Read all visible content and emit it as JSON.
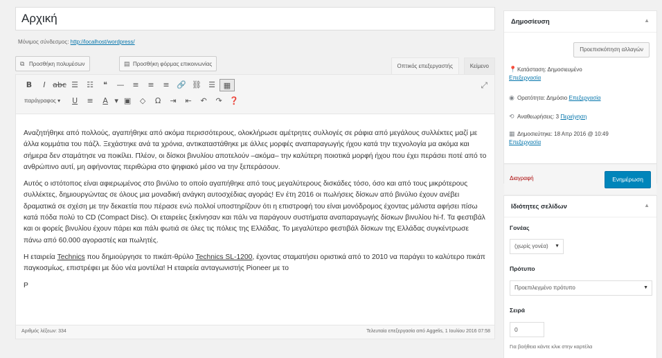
{
  "post": {
    "title": "Αρχική",
    "permalink_label": "Μόνιμος σύνδεσμος:",
    "permalink_url": "http://localhost/wordpress/"
  },
  "media": {
    "add_media": "Προσθήκη πολυμέσων",
    "add_form": "Προσθήκη φόρμας επικοινωνίας"
  },
  "editor_tabs": {
    "visual": "Οπτικός επεξεργαστής",
    "text": "Κείμενο"
  },
  "toolbar": {
    "row1": [
      "B",
      "I",
      "≡",
      "☰",
      "☷",
      "❝",
      "—",
      "≡",
      "≡",
      "≡",
      "🔗",
      "⛓",
      "☰",
      "▦"
    ],
    "row2": [
      "U",
      "≡",
      "A",
      "▾",
      "▣",
      "◇",
      "Ω",
      "⇥",
      "⇤",
      "↶",
      "↷",
      "❓"
    ],
    "format_select": "παράγραφος ▾",
    "expand_icon": "⤢"
  },
  "content": {
    "p1": "Αναζητήθηκε από πολλούς, αγαπήθηκε από ακόμα περισσότερους, ολοκλήρωσε αμέτρητες συλλογές σε ράφια από μεγάλους συλλέκτες μαζί με άλλα κομμάτια του πάζλ. Ξεχάστηκε ανά τα χρόνια, αντικαταστάθηκε με άλλες μορφές αναπαραγωγής ήχου κατά την τεχνολογία μα ακόμα και σήμερα δεν σταμάτησε να ποικίλει. Πλέον, οι δίσκοι βινυλίου αποτελούν –ακόμα– την καλύτερη ποιοτικά μορφή ήχου που έχει περάσει ποτέ από το ανθρώπινο αυτί, μη αφήνοντας περιθώρια στο ψηφιακό μέσο να την ξεπεράσουν.",
    "p2": "Αυτός ο ιστότοπος είναι αφιερωμένος στο βινύλιο το οποίο αγαπήθηκε από τους μεγαλύτερους δισκάδες τόσο, όσο και από τους μικρότερους συλλέκτες, δημιουργώντας σε όλους μια μοναδική ανάγκη αυτοσχέδιας αγοράς! Εν έτη 2016 οι πωλήσεις δίσκων από βινύλιο έχουν ανέβει δραματικά σε σχέση με την δεκαετία που πέρασε ενώ πολλοί υποστηρίζουν ότι η επιστροφή του είναι μονόδρομος έχοντας μάλιστα αφήσει πίσω κατά πόδα πολύ το CD (Compact Disc). Οι εταιρείες ξεκίνησαν και πάλι να παράγουν συστήματα αναπαραγωγής δίσκων βινυλίου hi-f. Τα φεστιβάλ και οι φορείς βινυλίου έχουν πάρει και πάλι φωτιά σε όλες τις πόλεις της Ελλάδας. Το μεγαλύτερο φεστιβάλ δίσκων της Ελλάδας συγκέντρωσε πάνω από 60.000 αγοραστές και πωλητές.",
    "p3_pre": "Η εταιρεία ",
    "p3_link1": "Technics",
    "p3_mid": " που δημιούργησε το πικάπ-θρύλο ",
    "p3_link2": "Technics SL-1200",
    "p3_post": ", έχοντας σταματήσει οριστικά από το 2010 να παράγει το καλύτερο πικάπ παγκοσμίως, επιστρέφει με δύο νέα μοντέλα! Η εταιρεία ανταγωνιστής Pioneer με το",
    "p4": "P"
  },
  "statusbar": {
    "word_count": "Αριθμός λέξεων: 334",
    "last_edit": "Τελευταία επεξεργασία από Aggelis, 1 Ιουλίου 2016 07:58"
  },
  "publish": {
    "title": "Δημοσίευση",
    "preview": "Προεπισκόπηση αλλαγών",
    "status_label": "Κατάσταση: Δημοσιευμένο",
    "visibility_label": "Ορατότητα: Δημόσιο",
    "revisions_label": "Αναθεωρήσεις: 3",
    "published_label": "Δημοσιεύτηκε: 18 Απρ 2016 @ 10:49",
    "edit_link": "Επεξεργασία",
    "browse_link": "Περιήγηση",
    "trash": "Διαγραφή",
    "update": "Ενημέρωση"
  },
  "page_attributes": {
    "title": "Ιδιότητες σελίδων",
    "parent_label": "Γονέας",
    "parent_value": "(χωρίς γονέα)",
    "template_label": "Πρότυπο",
    "template_value": "Προεπιλεγμένο πρότυπο",
    "order_label": "Σειρά",
    "order_value": "0",
    "help": "Για βοήθεια κάντε κλικ στην καρτέλα"
  }
}
